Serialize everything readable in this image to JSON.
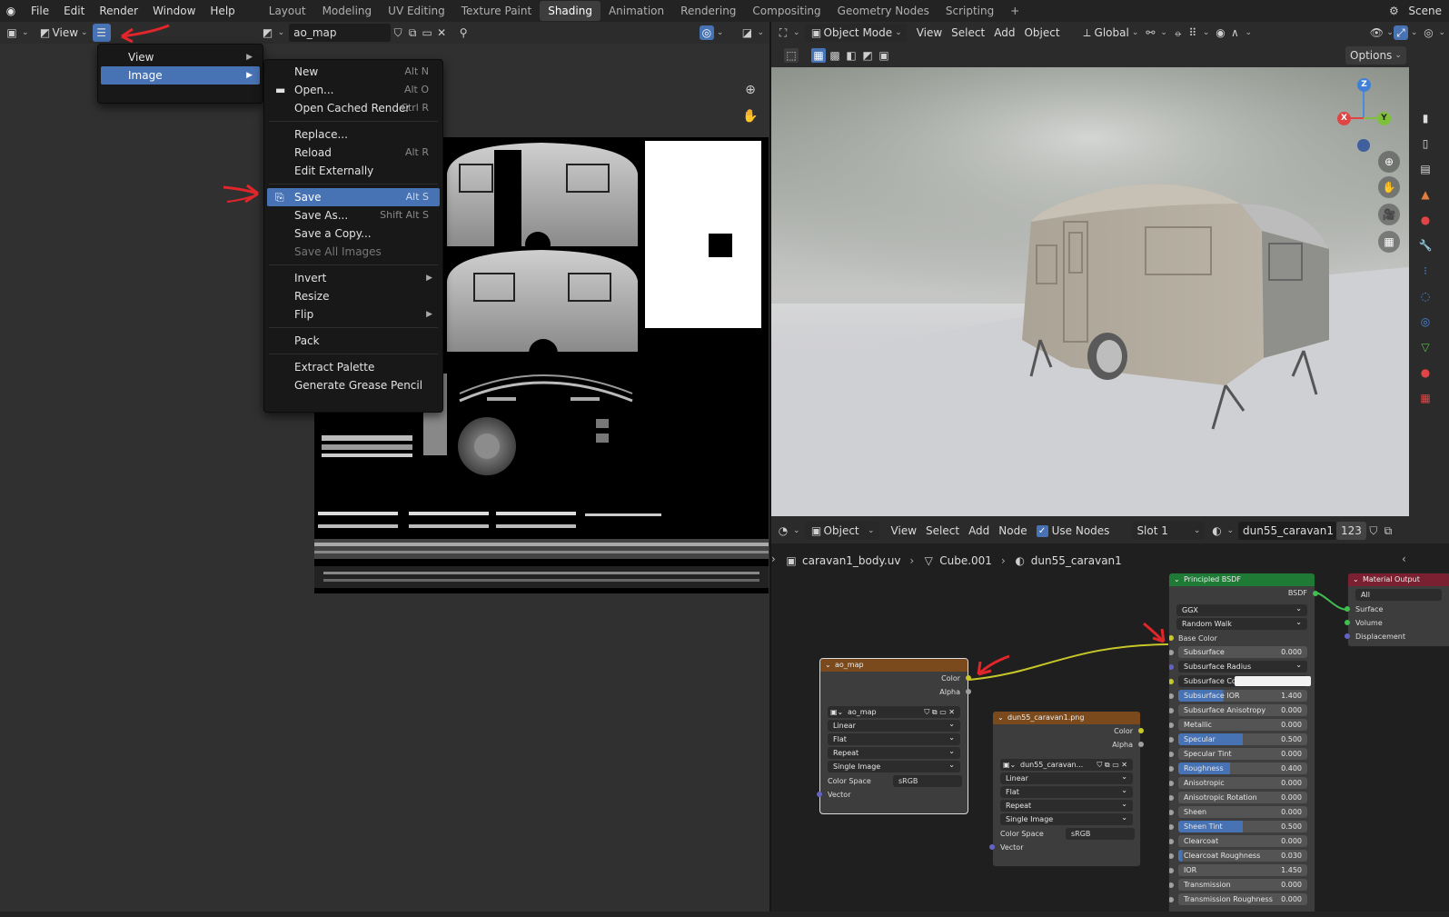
{
  "topbar": {
    "menus": [
      "File",
      "Edit",
      "Render",
      "Window",
      "Help"
    ],
    "workspaces": [
      "Layout",
      "Modeling",
      "UV Editing",
      "Texture Paint",
      "Shading",
      "Animation",
      "Rendering",
      "Compositing",
      "Geometry Nodes",
      "Scripting"
    ],
    "active_workspace": "Shading",
    "scene": "Scene"
  },
  "image_editor": {
    "view_label": "View",
    "image_name": "ao_map"
  },
  "main_menu": {
    "items": [
      {
        "label": "View"
      },
      {
        "label": "Image"
      }
    ]
  },
  "image_submenu": {
    "items": [
      {
        "label": "New",
        "shortcut": "Alt N"
      },
      {
        "label": "Open...",
        "shortcut": "Alt O"
      },
      {
        "label": "Open Cached Render",
        "shortcut": "Ctrl R"
      },
      {
        "label": "Replace...",
        "shortcut": ""
      },
      {
        "label": "Reload",
        "shortcut": "Alt R"
      },
      {
        "label": "Edit Externally",
        "shortcut": ""
      },
      {
        "label": "Save",
        "shortcut": "Alt S"
      },
      {
        "label": "Save As...",
        "shortcut": "Shift Alt S"
      },
      {
        "label": "Save a Copy...",
        "shortcut": ""
      },
      {
        "label": "Save All Images",
        "shortcut": ""
      },
      {
        "label": "Invert",
        "shortcut": ""
      },
      {
        "label": "Resize",
        "shortcut": ""
      },
      {
        "label": "Flip",
        "shortcut": ""
      },
      {
        "label": "Pack",
        "shortcut": ""
      },
      {
        "label": "Extract Palette",
        "shortcut": ""
      },
      {
        "label": "Generate Grease Pencil",
        "shortcut": ""
      }
    ]
  },
  "viewport": {
    "mode": "Object Mode",
    "menus": [
      "View",
      "Select",
      "Add",
      "Object"
    ],
    "orientation": "Global",
    "options": "Options",
    "gizmo": {
      "z": "Z",
      "x": "X",
      "y": "Y"
    }
  },
  "node_editor": {
    "type": "Object",
    "menus": [
      "View",
      "Select",
      "Add",
      "Node"
    ],
    "use_nodes": "Use Nodes",
    "slot": "Slot 1",
    "material": "dun55_caravan1",
    "users": "123",
    "breadcrumb": [
      "caravan1_body.uv",
      "Cube.001",
      "dun55_caravan1"
    ]
  },
  "node_ao": {
    "title": "ao_map",
    "outputs": [
      "Color",
      "Alpha"
    ],
    "image": "ao_map",
    "interp": "Linear",
    "proj": "Flat",
    "ext": "Repeat",
    "source": "Single Image",
    "cs_label": "Color Space",
    "cs": "sRGB",
    "input": "Vector"
  },
  "node_dun": {
    "title": "dun55_caravan1.png",
    "outputs": [
      "Color",
      "Alpha"
    ],
    "image": "dun55_caravan...",
    "interp": "Linear",
    "proj": "Flat",
    "ext": "Repeat",
    "source": "Single Image",
    "cs_label": "Color Space",
    "cs": "sRGB",
    "input": "Vector"
  },
  "node_bsdf": {
    "title": "Principled BSDF",
    "out": "BSDF",
    "dist": "GGX",
    "sss": "Random Walk",
    "base": "Base Color",
    "fields": [
      {
        "l": "Subsurface",
        "v": "0.000",
        "p": 0
      },
      {
        "l": "Subsurface Radius",
        "v": "",
        "p": 0,
        "dd": true
      },
      {
        "l": "Subsurface Co...",
        "v": "",
        "p": 0,
        "white": true
      },
      {
        "l": "Subsurface IOR",
        "v": "1.400",
        "p": 35
      },
      {
        "l": "Subsurface Anisotropy",
        "v": "0.000",
        "p": 0
      },
      {
        "l": "Metallic",
        "v": "0.000",
        "p": 0
      },
      {
        "l": "Specular",
        "v": "0.500",
        "p": 50
      },
      {
        "l": "Specular Tint",
        "v": "0.000",
        "p": 0
      },
      {
        "l": "Roughness",
        "v": "0.400",
        "p": 40
      },
      {
        "l": "Anisotropic",
        "v": "0.000",
        "p": 0
      },
      {
        "l": "Anisotropic Rotation",
        "v": "0.000",
        "p": 0
      },
      {
        "l": "Sheen",
        "v": "0.000",
        "p": 0
      },
      {
        "l": "Sheen Tint",
        "v": "0.500",
        "p": 50
      },
      {
        "l": "Clearcoat",
        "v": "0.000",
        "p": 0
      },
      {
        "l": "Clearcoat Roughness",
        "v": "0.030",
        "p": 3
      },
      {
        "l": "IOR",
        "v": "1.450",
        "p": 0
      },
      {
        "l": "Transmission",
        "v": "0.000",
        "p": 0
      },
      {
        "l": "Transmission Roughness",
        "v": "0.000",
        "p": 0
      }
    ]
  },
  "node_out": {
    "title": "Material Output",
    "target": "All",
    "inputs": [
      "Surface",
      "Volume",
      "Displacement"
    ]
  }
}
